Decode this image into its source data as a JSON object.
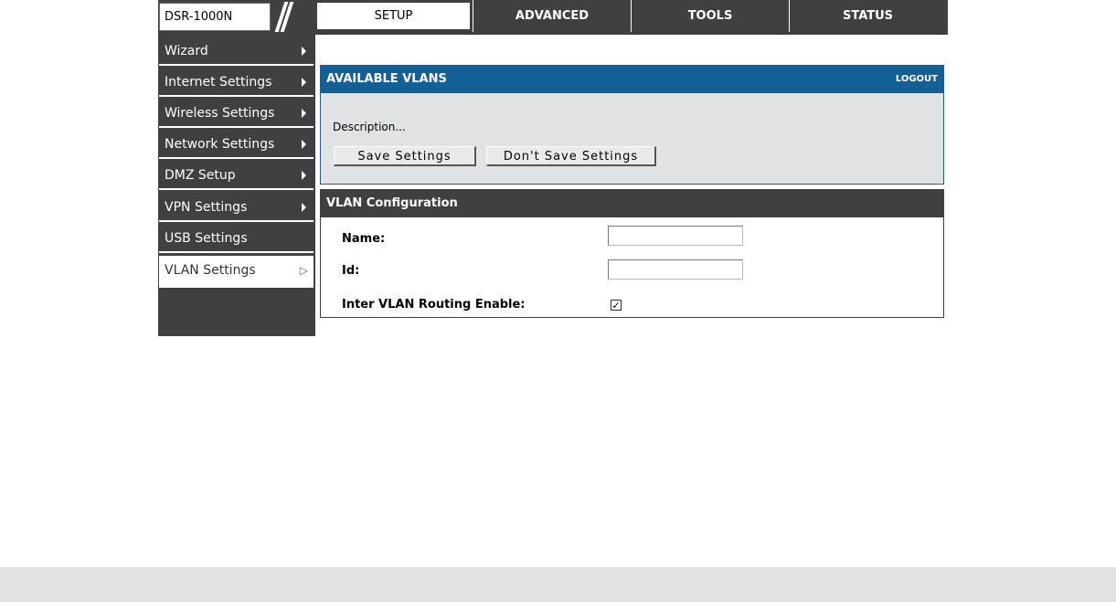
{
  "header": {
    "model": "DSR-1000N",
    "tabs": [
      {
        "label": "SETUP",
        "active": true
      },
      {
        "label": "ADVANCED",
        "active": false
      },
      {
        "label": "TOOLS",
        "active": false
      },
      {
        "label": "STATUS",
        "active": false
      }
    ]
  },
  "sidebar": {
    "items": [
      {
        "label": "Wizard"
      },
      {
        "label": "Internet Settings"
      },
      {
        "label": "Wireless Settings"
      },
      {
        "label": "Network Settings"
      },
      {
        "label": "DMZ Setup"
      },
      {
        "label": "VPN Settings"
      },
      {
        "label": "USB Settings"
      },
      {
        "label": "VLAN Settings",
        "active": true
      }
    ]
  },
  "vlans_panel": {
    "title": "AVAILABLE VLANS",
    "logout": "LOGOUT",
    "description": "Description...",
    "save_label": "Save Settings",
    "dont_save_label": "Don't Save Settings"
  },
  "vlan_config": {
    "title": "VLAN Configuration",
    "name_label": "Name:",
    "name_value": "",
    "id_label": "Id:",
    "id_value": "",
    "routing_label": "Inter VLAN Routing Enable:",
    "routing_checked": true
  },
  "colors": {
    "dark": "#404040",
    "blue_header": "#155f97",
    "panel_bg": "#dfe3e6"
  }
}
